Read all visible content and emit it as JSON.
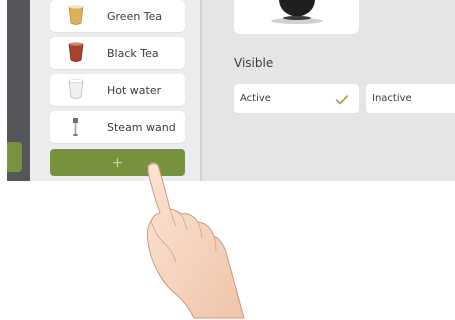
{
  "beverage_list": {
    "items": [
      {
        "label": "Green Tea",
        "icon": "green-tea-cup-icon"
      },
      {
        "label": "Black Tea",
        "icon": "black-tea-cup-icon"
      },
      {
        "label": "Hot water",
        "icon": "hot-water-cup-icon"
      },
      {
        "label": "Steam wand",
        "icon": "steam-wand-icon"
      }
    ],
    "add_button": {
      "label": "+",
      "icon": "plus-icon"
    }
  },
  "settings": {
    "visible_label": "Visible",
    "options": [
      {
        "label": "Active",
        "selected": true
      },
      {
        "label": "Inactive",
        "selected": false
      }
    ]
  },
  "colors": {
    "accent_green": "#76923d",
    "check_color": "#b79a5a",
    "panel_bg": "#e4e5e6",
    "sidebar_dark": "#55565a"
  }
}
